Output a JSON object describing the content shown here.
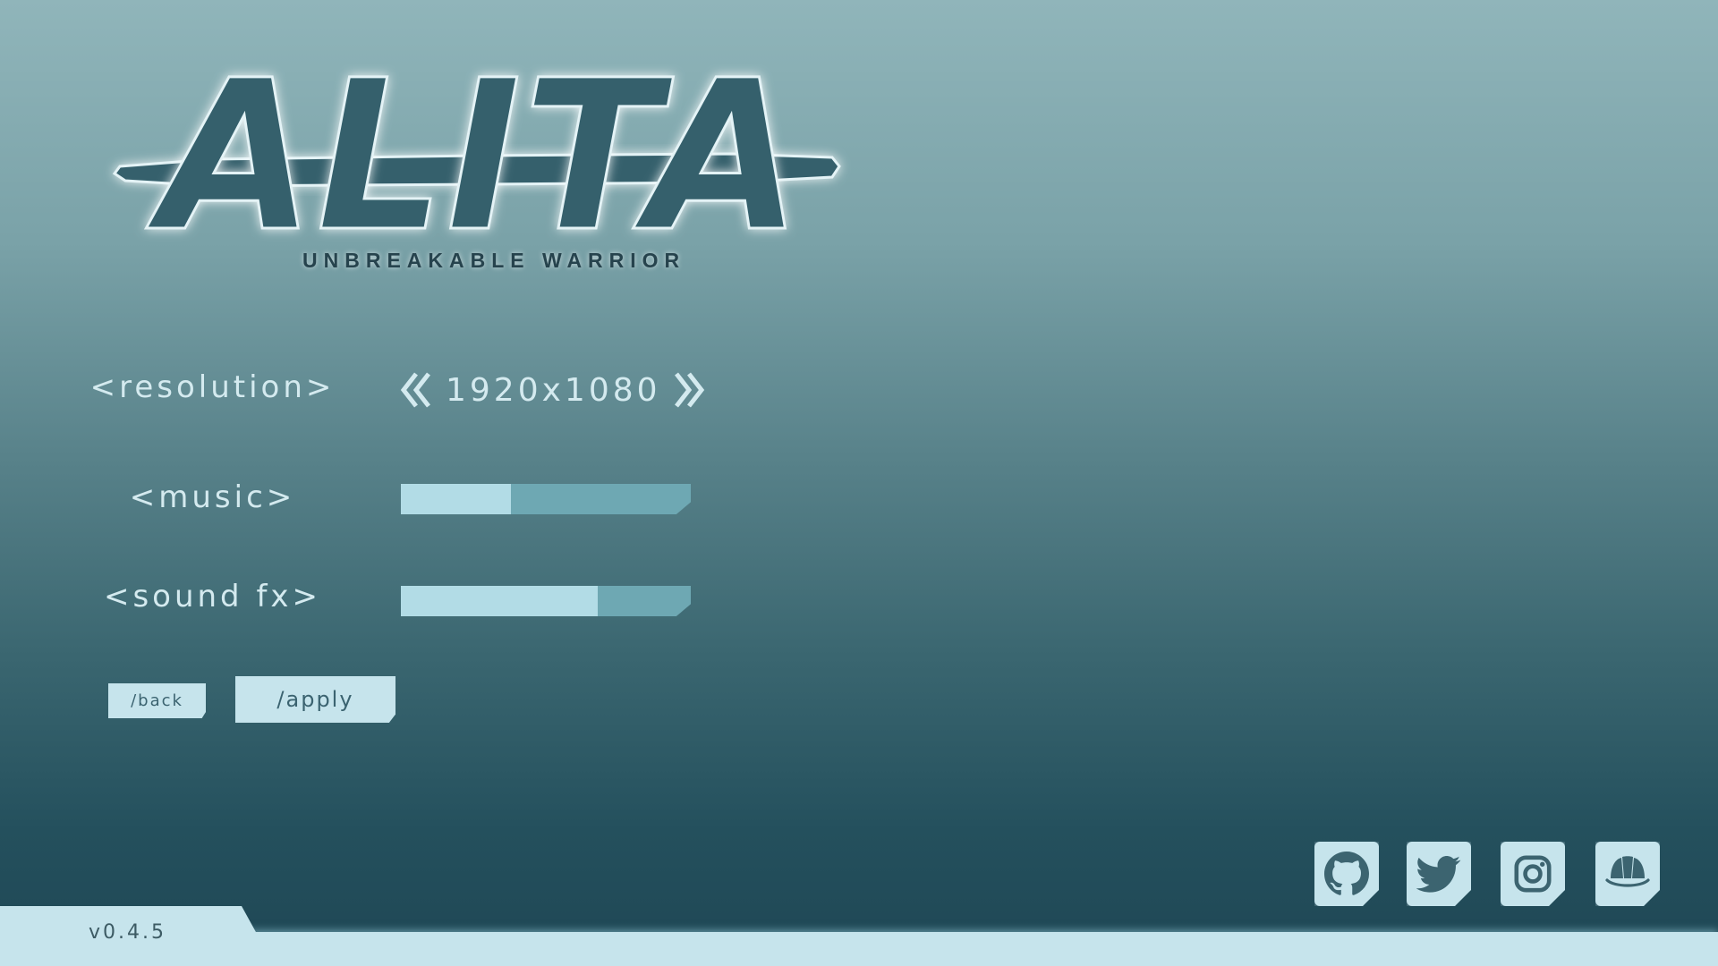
{
  "logo": {
    "title": "ALITA",
    "subtitle": "UNBREAKABLE WARRIOR"
  },
  "settings": {
    "resolution": {
      "label": "<resolution>",
      "value": "1920x1080",
      "prev_icon": "double-chevron-left-icon",
      "next_icon": "double-chevron-right-icon"
    },
    "music": {
      "label": "<music>",
      "level_fraction": 0.38
    },
    "sound_fx": {
      "label": "<sound fx>",
      "level_fraction": 0.68
    }
  },
  "buttons": {
    "back_label": "/back",
    "apply_label": "/apply"
  },
  "social": [
    {
      "name": "github-icon"
    },
    {
      "name": "twitter-icon"
    },
    {
      "name": "instagram-icon"
    },
    {
      "name": "itchio-icon"
    }
  ],
  "footer": {
    "version": "v0.4.5"
  },
  "colors": {
    "background_top": "#90b5ba",
    "background_bottom": "#1f4755",
    "panel_light": "#c6e4ec",
    "slider_fill": "#b2dce6",
    "slider_track": "#6ea8b3",
    "logo_fill": "#35606c",
    "label_text": "#d4eaef"
  }
}
